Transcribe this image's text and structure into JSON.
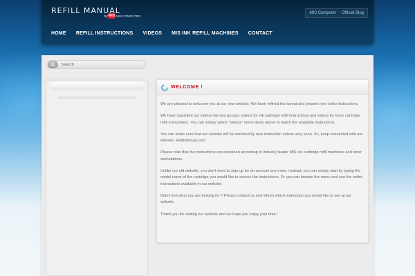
{
  "header": {
    "logo_text": "REFILL MANUAL",
    "logo_by": "by",
    "logo_badge": "MIS",
    "logo_company": "MIS COMPUTER",
    "top_links": [
      "MIS Computer",
      "Official Blog"
    ]
  },
  "nav": {
    "items": [
      "HOME",
      "REFILL INSTRUCTIONS",
      "VIDEOS",
      "MIS INK REFILL MACHINES",
      "CONTACT"
    ]
  },
  "search": {
    "placeholder": "Search",
    "icon": "search-icon"
  },
  "main": {
    "title": "WELCOME !",
    "icon": "spinner-icon",
    "paragraphs": [
      "We are pleased to welcome you at our new website. We have refined the layout and present new video instructions.",
      "We have classified our videos into two groups; videos for ink cartridge refill instructions and videos for toner cartridge refill instructions. You can simply select \"Videos\" menu items above to watch the available instructions.",
      "You can make sure that our website will be enriched by new instruction videos very soon. So, keep connected with our website, RefillManual.com.",
      "Please note that the instructions are explained according to industry leader MIS ink cartridge refill machines and toner workstations.",
      "Unlike our old website, you don't need to sign up for an account any more. Instead, you can simply start by typing the model name of the cartridge you would like to access the instructions. Or you can browse the menu and see the entire instructions available in our website.",
      "Didn't find what you are looking for ? Please contact us and inform which instruction you would like to see at our website.",
      "Thank you for visiting our website and we hope you enjoy your time !"
    ]
  },
  "colors": {
    "title_red": "#c3161c",
    "header_dark": "#0a3558",
    "link_blue": "#9fcdf0"
  }
}
